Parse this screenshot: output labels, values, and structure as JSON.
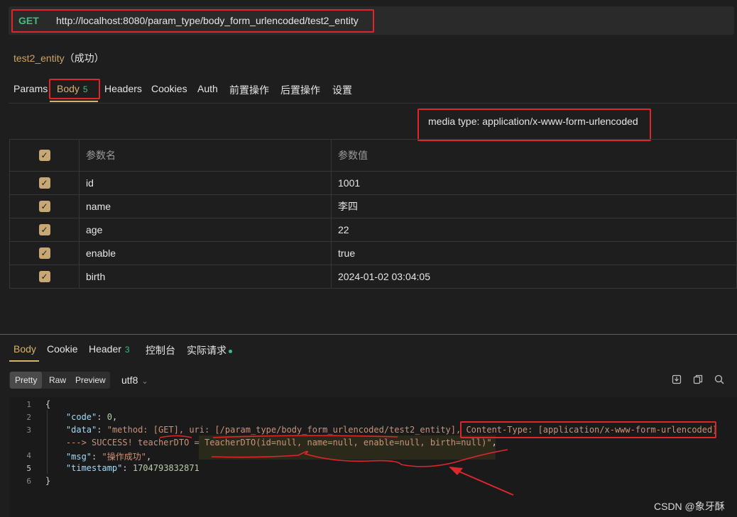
{
  "request": {
    "method": "GET",
    "url": "http://localhost:8080/param_type/body_form_urlencoded/test2_entity",
    "name": "test2_entity",
    "status": "（成功）"
  },
  "request_tabs": [
    {
      "label": "Params"
    },
    {
      "label": "Body",
      "badge": "5"
    },
    {
      "label": "Headers"
    },
    {
      "label": "Cookies"
    },
    {
      "label": "Auth"
    },
    {
      "label": "前置操作"
    },
    {
      "label": "后置操作"
    },
    {
      "label": "设置"
    }
  ],
  "body": {
    "media_type": "media type: application/x-www-form-urlencoded",
    "columns": [
      "参数名",
      "参数值"
    ],
    "rows": [
      {
        "name": "id",
        "value": "1001"
      },
      {
        "name": "name",
        "value": "李四"
      },
      {
        "name": "age",
        "value": "22"
      },
      {
        "name": "enable",
        "value": "true"
      },
      {
        "name": "birth",
        "value": "2024-01-02 03:04:05"
      }
    ]
  },
  "response_tabs": [
    {
      "label": "Body"
    },
    {
      "label": "Cookie"
    },
    {
      "label": "Header",
      "badge": "3"
    },
    {
      "label": "控制台"
    },
    {
      "label": "实际请求"
    }
  ],
  "view_modes": [
    "Pretty",
    "Raw",
    "Preview"
  ],
  "encoding": "utf8",
  "code": {
    "line_numbers": [
      "1",
      "2",
      "3",
      "4",
      "5",
      "6"
    ],
    "open_brace": "{",
    "close_brace": "}",
    "code_key": "\"code\"",
    "code_val": "0",
    "data_key": "\"data\"",
    "data_val_1": "\"method: [GET], uri: [/param_type/body_form_urlencoded/test2_entity], Content-Type: [application/x-www-form-urlencoded]",
    "data_val_2": "---> SUCCESS! teacherDTO = TeacherDTO(id=null, name=null, enable=null, birth=null)\"",
    "msg_key": "\"msg\"",
    "msg_val": "\"操作成功\"",
    "ts_key": "\"timestamp\"",
    "ts_val": "1704793832871"
  },
  "watermark": "CSDN @象牙酥",
  "colors": {
    "accent": "#d8b26a",
    "method_green": "#3fbf7f",
    "annotation_red": "#e0262b"
  },
  "icons": [
    "download-icon",
    "copy-icon",
    "search-icon",
    "check-icon",
    "chevron-down-icon"
  ]
}
